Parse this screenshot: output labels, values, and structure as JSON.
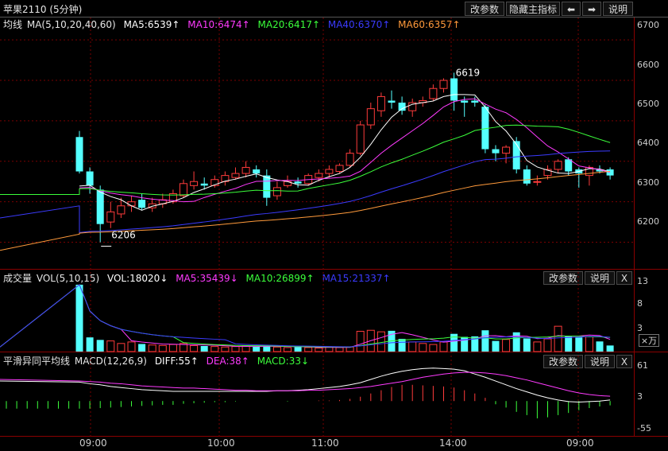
{
  "window": {
    "title": "苹果2110 (5分钟)",
    "buttons": {
      "params": "改参数",
      "hide_indicator": "隐藏主指标",
      "left": "⬅",
      "right": "➡",
      "help": "说明"
    }
  },
  "colors": {
    "up": "#ff3b3b",
    "down": "#54ffff",
    "white": "#ffffff",
    "magenta": "#ff3bff",
    "green": "#3bff3b",
    "blue": "#3b3bff",
    "orange": "#ff9a3b",
    "grid": "#7a0000"
  },
  "main_panel": {
    "legend": {
      "name": "均线",
      "params": "MA(5,10,20,40,60)",
      "ma5": "MA5:6539↑",
      "ma10": "MA10:6474↑",
      "ma20": "MA20:6417↑",
      "ma40": "MA40:6370↑",
      "ma60": "MA60:6357↑"
    },
    "y_ticks": [
      "6700",
      "6600",
      "6500",
      "6400",
      "6300",
      "6200"
    ],
    "annotations": {
      "high": "6619",
      "low": "6206"
    }
  },
  "volume_panel": {
    "legend": {
      "name": "成交量",
      "params": "VOL(5,10,15)",
      "vol": "VOL:18020↓",
      "ma5": "MA5:35439↓",
      "ma10": "MA10:26899↑",
      "ma15": "MA15:21337↑"
    },
    "y_ticks": [
      "13",
      "8",
      "3"
    ],
    "unit": "×万",
    "buttons": {
      "params": "改参数",
      "help": "说明",
      "close": "X"
    }
  },
  "macd_panel": {
    "legend": {
      "name": "平滑异同平均线",
      "params": "MACD(12,26,9)",
      "diff": "DIFF:55↑",
      "dea": "DEA:38↑",
      "macd": "MACD:33↓"
    },
    "y_ticks": [
      "61",
      "3",
      "-55"
    ],
    "buttons": {
      "params": "改参数",
      "help": "说明",
      "close": "X"
    }
  },
  "x_axis": {
    "labels": [
      "09:00",
      "10:00",
      "11:00",
      "14:00",
      "09:00"
    ]
  },
  "chart_data": {
    "type": "candlestick",
    "ylim": [
      6150,
      6720
    ],
    "candles": [
      {
        "o": 6460,
        "h": 6475,
        "l": 6370,
        "c": 6375
      },
      {
        "o": 6375,
        "h": 6385,
        "l": 6320,
        "c": 6340
      },
      {
        "o": 6330,
        "h": 6340,
        "l": 6200,
        "c": 6245
      },
      {
        "o": 6250,
        "h": 6300,
        "l": 6235,
        "c": 6275
      },
      {
        "o": 6270,
        "h": 6310,
        "l": 6260,
        "c": 6290
      },
      {
        "o": 6290,
        "h": 6315,
        "l": 6275,
        "c": 6300
      },
      {
        "o": 6305,
        "h": 6320,
        "l": 6280,
        "c": 6285
      },
      {
        "o": 6285,
        "h": 6310,
        "l": 6275,
        "c": 6295
      },
      {
        "o": 6295,
        "h": 6320,
        "l": 6285,
        "c": 6305
      },
      {
        "o": 6300,
        "h": 6330,
        "l": 6295,
        "c": 6320
      },
      {
        "o": 6315,
        "h": 6355,
        "l": 6310,
        "c": 6345
      },
      {
        "o": 6340,
        "h": 6375,
        "l": 6330,
        "c": 6350
      },
      {
        "o": 6345,
        "h": 6360,
        "l": 6330,
        "c": 6340
      },
      {
        "o": 6340,
        "h": 6365,
        "l": 6335,
        "c": 6355
      },
      {
        "o": 6350,
        "h": 6375,
        "l": 6340,
        "c": 6365
      },
      {
        "o": 6360,
        "h": 6385,
        "l": 6355,
        "c": 6370
      },
      {
        "o": 6370,
        "h": 6400,
        "l": 6360,
        "c": 6385
      },
      {
        "o": 6380,
        "h": 6390,
        "l": 6360,
        "c": 6370
      },
      {
        "o": 6365,
        "h": 6380,
        "l": 6290,
        "c": 6310
      },
      {
        "o": 6315,
        "h": 6350,
        "l": 6305,
        "c": 6335
      },
      {
        "o": 6340,
        "h": 6365,
        "l": 6335,
        "c": 6350
      },
      {
        "o": 6350,
        "h": 6360,
        "l": 6335,
        "c": 6345
      },
      {
        "o": 6345,
        "h": 6370,
        "l": 6340,
        "c": 6365
      },
      {
        "o": 6360,
        "h": 6380,
        "l": 6350,
        "c": 6370
      },
      {
        "o": 6370,
        "h": 6390,
        "l": 6360,
        "c": 6380
      },
      {
        "o": 6375,
        "h": 6395,
        "l": 6370,
        "c": 6390
      },
      {
        "o": 6390,
        "h": 6430,
        "l": 6385,
        "c": 6420
      },
      {
        "o": 6420,
        "h": 6500,
        "l": 6415,
        "c": 6490
      },
      {
        "o": 6490,
        "h": 6545,
        "l": 6480,
        "c": 6530
      },
      {
        "o": 6525,
        "h": 6570,
        "l": 6510,
        "c": 6560
      },
      {
        "o": 6550,
        "h": 6575,
        "l": 6530,
        "c": 6545
      },
      {
        "o": 6545,
        "h": 6560,
        "l": 6515,
        "c": 6525
      },
      {
        "o": 6525,
        "h": 6555,
        "l": 6510,
        "c": 6545
      },
      {
        "o": 6545,
        "h": 6560,
        "l": 6535,
        "c": 6550
      },
      {
        "o": 6555,
        "h": 6590,
        "l": 6550,
        "c": 6580
      },
      {
        "o": 6580,
        "h": 6605,
        "l": 6570,
        "c": 6600
      },
      {
        "o": 6605,
        "h": 6619,
        "l": 6525,
        "c": 6550
      },
      {
        "o": 6550,
        "h": 6560,
        "l": 6510,
        "c": 6545
      },
      {
        "o": 6550,
        "h": 6560,
        "l": 6535,
        "c": 6545
      },
      {
        "o": 6535,
        "h": 6540,
        "l": 6420,
        "c": 6430
      },
      {
        "o": 6430,
        "h": 6440,
        "l": 6400,
        "c": 6420
      },
      {
        "o": 6420,
        "h": 6440,
        "l": 6395,
        "c": 6435
      },
      {
        "o": 6450,
        "h": 6460,
        "l": 6370,
        "c": 6380
      },
      {
        "o": 6380,
        "h": 6390,
        "l": 6340,
        "c": 6345
      },
      {
        "o": 6350,
        "h": 6365,
        "l": 6340,
        "c": 6350
      },
      {
        "o": 6365,
        "h": 6390,
        "l": 6355,
        "c": 6380
      },
      {
        "o": 6380,
        "h": 6405,
        "l": 6370,
        "c": 6400
      },
      {
        "o": 6405,
        "h": 6410,
        "l": 6365,
        "c": 6375
      },
      {
        "o": 6380,
        "h": 6385,
        "l": 6335,
        "c": 6370
      },
      {
        "o": 6365,
        "h": 6390,
        "l": 6340,
        "c": 6385
      },
      {
        "o": 6380,
        "h": 6390,
        "l": 6370,
        "c": 6375
      },
      {
        "o": 6380,
        "h": 6385,
        "l": 6355,
        "c": 6365
      }
    ],
    "volume": [
      13.2,
      2.8,
      2.3,
      2.1,
      1.6,
      1.9,
      1.5,
      1.3,
      1.2,
      1.4,
      1.6,
      1.2,
      1.1,
      1.0,
      0.9,
      1.0,
      1.1,
      1.0,
      1.2,
      0.9,
      0.8,
      0.9,
      0.8,
      0.7,
      0.9,
      0.8,
      0.9,
      4.0,
      4.2,
      3.9,
      4.1,
      2.5,
      1.9,
      1.6,
      1.4,
      1.9,
      3.5,
      2.9,
      3.0,
      4.2,
      2.1,
      2.4,
      3.8,
      2.6,
      1.9,
      2.5,
      5.0,
      3.1,
      2.8,
      2.9,
      2.0,
      1.2
    ],
    "macd_hist": [
      -14,
      -14,
      -13,
      -12,
      -11,
      -10,
      -9,
      -8,
      -7,
      -7,
      -5,
      -4,
      -3,
      -2,
      -2,
      -1,
      0,
      0,
      0,
      0,
      -1,
      0,
      0,
      1,
      1,
      2,
      4,
      8,
      14,
      20,
      26,
      30,
      30,
      29,
      28,
      27,
      25,
      20,
      14,
      6,
      -6,
      -12,
      -20,
      -26,
      -32,
      -30,
      -26,
      -22,
      -17,
      -13,
      -10,
      -8
    ],
    "macd_ylim": [
      -60,
      65
    ]
  }
}
